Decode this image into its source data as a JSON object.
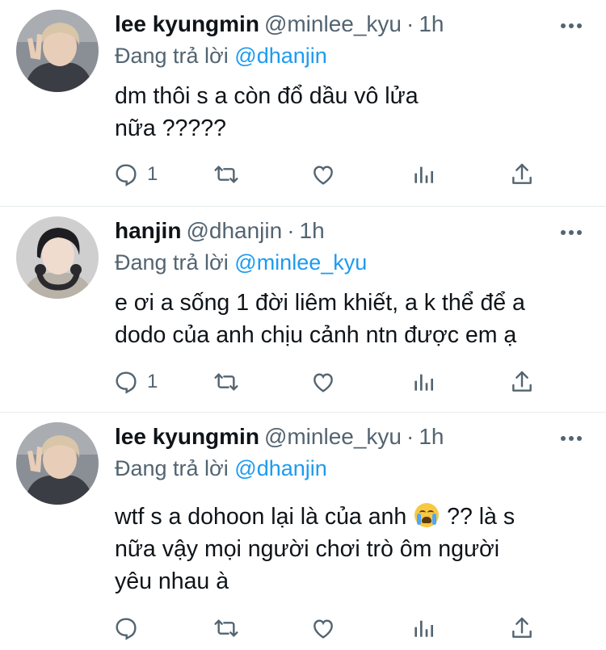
{
  "tweets": [
    {
      "name": "lee kyungmin",
      "handle": "@minlee_kyu",
      "dot": "·",
      "time": "1h",
      "reply_prefix": "Đang trả lời",
      "reply_to": "@dhanjin",
      "lines": [
        "dm thôi s a còn đổ dầu vô lửa",
        "nữa ?????"
      ],
      "reply_count": "1",
      "avatar_icon": "profile-photo-peace-sign",
      "colors": {
        "bg": "#8a8f96",
        "hair": "#d9c6a8",
        "skin": "#e8cdb8",
        "shirt": "#3a3d44"
      }
    },
    {
      "name": "hanjin",
      "handle": "@dhanjin",
      "dot": "·",
      "time": "1h",
      "reply_prefix": "Đang trả lời",
      "reply_to": "@minlee_kyu",
      "lines": [
        "e ơi a sống 1 đời liêm khiết, a k thể để a",
        "dodo của anh chịu cảnh ntn được em ạ"
      ],
      "reply_count": "1",
      "avatar_icon": "profile-photo-headphones",
      "colors": {
        "bg": "#cfcfcf",
        "hair": "#1e1e22",
        "skin": "#efdccf",
        "shirt": "#b9b2a8"
      }
    },
    {
      "name": "lee kyungmin",
      "handle": "@minlee_kyu",
      "dot": "·",
      "time": "1h",
      "reply_prefix": "Đang trả lời",
      "reply_to": "@dhanjin",
      "line1_before": "wtf s a dohoon lại là của anh",
      "line1_after": "?? là s",
      "lines_rest": [
        "nữa vậy mọi người chơi trò ôm người",
        "yêu nhau à"
      ],
      "reply_count": "",
      "emoji_icon": "loudly-crying-face-emoji",
      "avatar_icon": "profile-photo-peace-sign",
      "colors": {
        "bg": "#8a8f96",
        "hair": "#d9c6a8",
        "skin": "#e8cdb8",
        "shirt": "#3a3d44"
      }
    }
  ],
  "theme": {
    "text": "#0f1419",
    "secondary": "#536471",
    "link": "#1d9bf0",
    "divider": "#e6ecf0"
  },
  "action_icons": [
    "reply-icon",
    "retweet-icon",
    "like-icon",
    "analytics-icon",
    "share-icon"
  ]
}
